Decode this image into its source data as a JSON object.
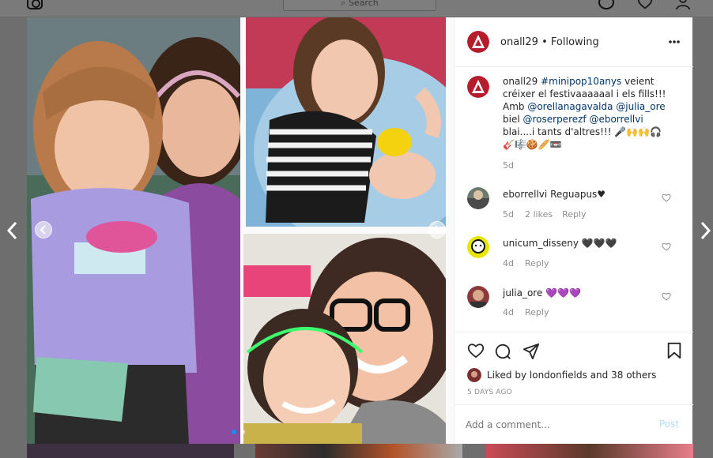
{
  "background": {
    "search_placeholder": "Search"
  },
  "post": {
    "author": "onall29",
    "separator": " • ",
    "follow_status": "Following",
    "caption": {
      "lines": [
        [
          "onall29",
          " ",
          "#minipop10anys",
          " veient"
        ],
        [
          "créixer el festivaaaaaal i els fills!!!"
        ],
        [
          "Amb ",
          "@orellanagavalda",
          " ",
          "@julia_ore"
        ],
        [
          "biel ",
          "@roserperezf",
          " ",
          "@eborrellvi"
        ],
        [
          "blai....i tants d'altres!!! 🎤🙌🙌🎧"
        ],
        [
          "🎸🎼🍪🥖📼"
        ]
      ],
      "time": "5d"
    },
    "comments": [
      {
        "user": "eborrellvi",
        "text": "Reguapus♥",
        "time": "5d",
        "likes": "2 likes",
        "reply": "Reply"
      },
      {
        "user": "unicum_disseny",
        "text": "🖤🖤🖤",
        "time": "4d",
        "reply": "Reply"
      },
      {
        "user": "julia_ore",
        "text": "💜💜💜",
        "time": "4d",
        "reply": "Reply"
      }
    ],
    "liked_by": {
      "prefix": "Liked by ",
      "user": "londonfields",
      "suffix": " and ",
      "others": "38 others"
    },
    "posted": "5 DAYS AGO",
    "comment_placeholder": "Add a comment...",
    "post_button": "Post"
  },
  "colors": {
    "accent": "#0095f6",
    "text": "#262626",
    "muted": "#8e8e8e",
    "border": "#efefef",
    "tag": "#003569"
  }
}
